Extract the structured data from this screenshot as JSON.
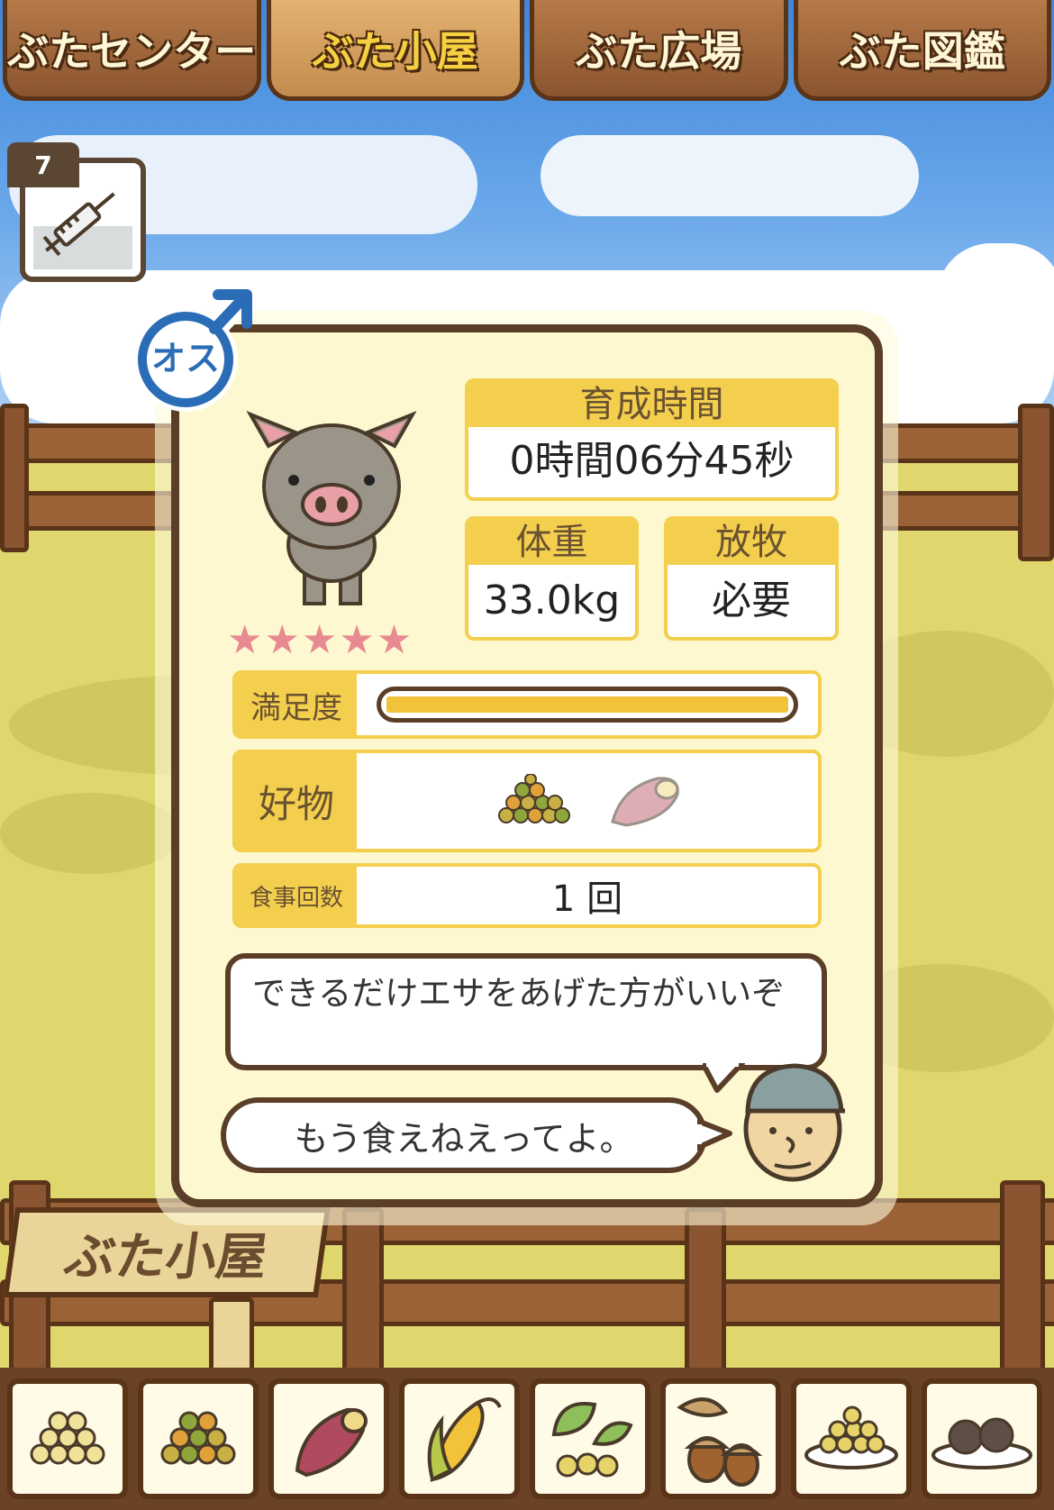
{
  "tabs": [
    {
      "label": "ぶたセンター",
      "active": false
    },
    {
      "label": "ぶた小屋",
      "active": true
    },
    {
      "label": "ぶた広場",
      "active": false
    },
    {
      "label": "ぶた図鑑",
      "active": false
    }
  ],
  "item": {
    "count": "7",
    "icon": "syringe-icon"
  },
  "pig": {
    "gender": "オス",
    "stars": "★★★★★",
    "growth_time_label": "育成時間",
    "growth_time_value": "0時間06分45秒",
    "weight_label": "体重",
    "weight_value": "33.0kg",
    "grazing_label": "放牧",
    "grazing_value": "必要",
    "satisfaction_label": "満足度",
    "satisfaction_level": 1.0,
    "favorite_label": "好物",
    "favorite_icons": [
      "beans-icon",
      "sweet-potato-icon"
    ],
    "meals_label": "食事回数",
    "meals_value": "1 回"
  },
  "dialog": {
    "farmer_message": "できるだけエサをあげた方がいいぞ",
    "pig_message": "もう食えねえってよ。"
  },
  "sign": "ぶた小屋",
  "foods": [
    "soybeans-icon",
    "mixed-beans-icon",
    "sweet-potato-icon",
    "corn-icon",
    "vegetables-icon",
    "acorns-icon",
    "feed-plate-icon",
    "meat-plate-icon"
  ],
  "colors": {
    "accent": "#f4cf4e",
    "frame": "#5a3e28",
    "card": "#fdf8d0"
  }
}
